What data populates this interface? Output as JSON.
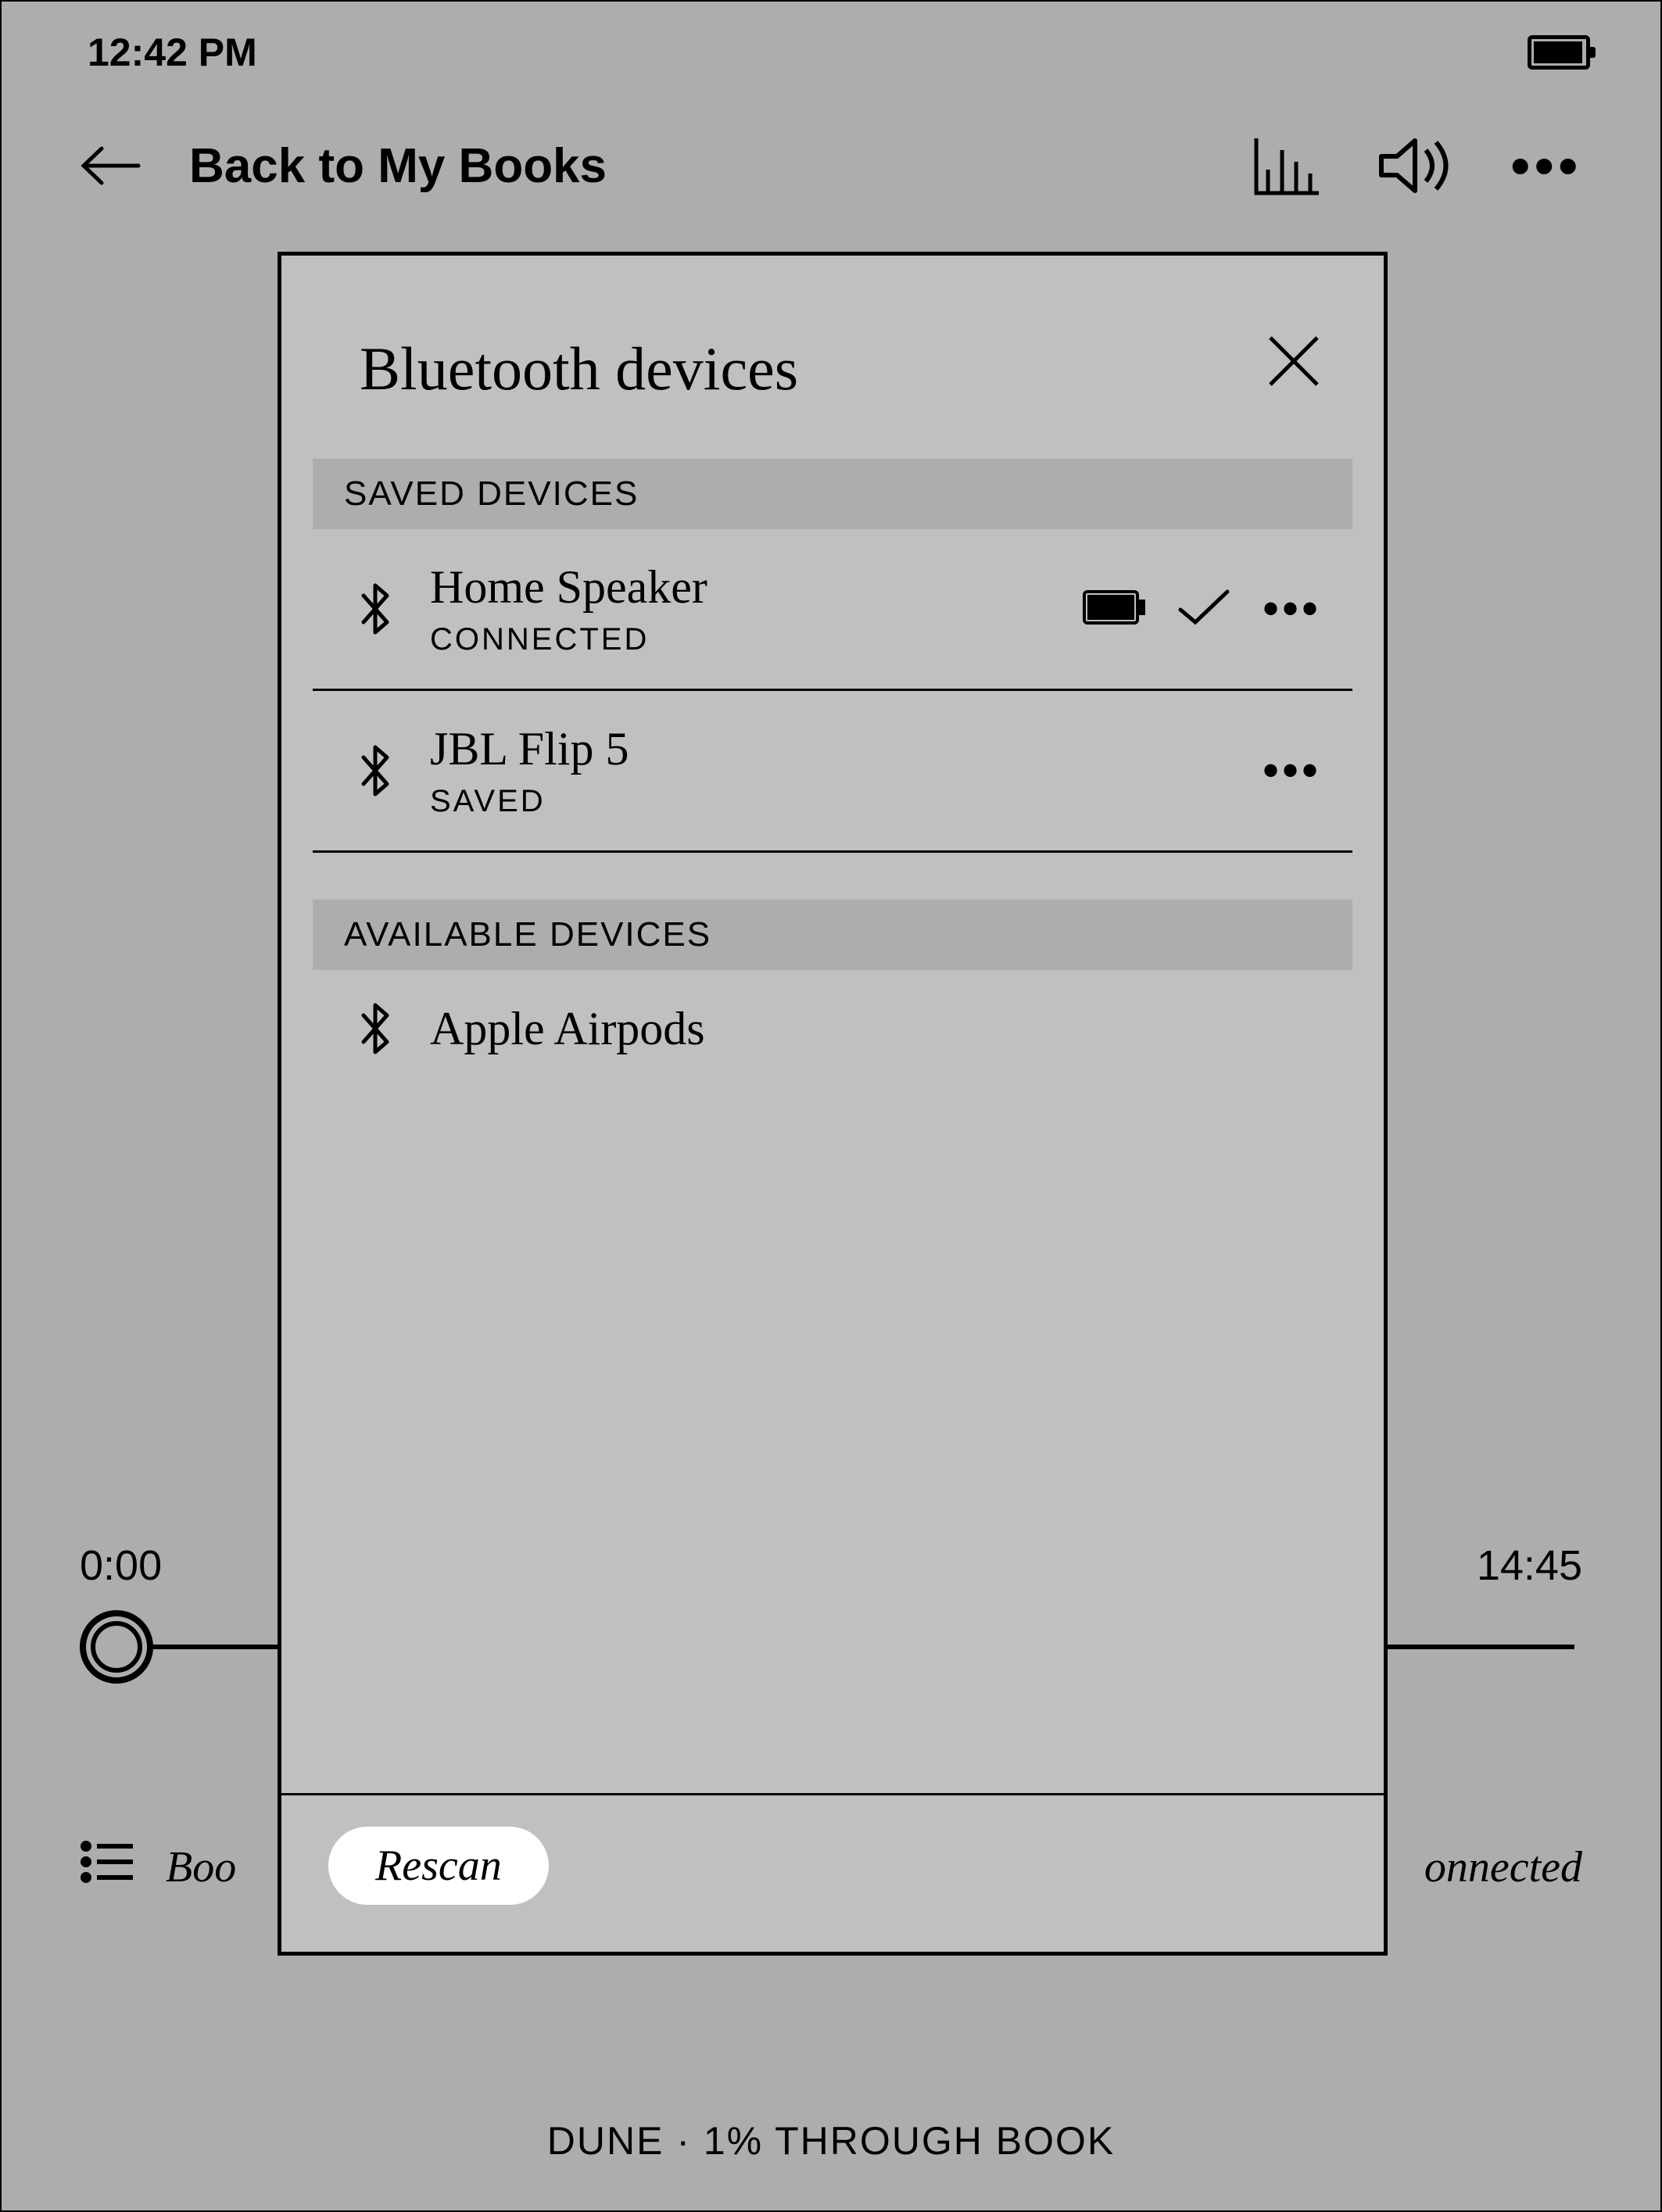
{
  "status": {
    "time": "12:42 PM"
  },
  "nav": {
    "back_label": "Back to My Books"
  },
  "playback": {
    "elapsed": "0:00",
    "remaining": "14:45"
  },
  "bottom": {
    "left_truncated": "Boo",
    "right_truncated": "onnected"
  },
  "footer": {
    "text": "DUNE · 1% THROUGH BOOK"
  },
  "modal": {
    "title": "Bluetooth devices",
    "saved_header": "SAVED DEVICES",
    "available_header": "AVAILABLE DEVICES",
    "rescan_label": "Rescan",
    "saved_devices": [
      {
        "name": "Home Speaker",
        "status": "CONNECTED",
        "show_battery": true,
        "show_check": true
      },
      {
        "name": "JBL Flip 5",
        "status": "SAVED",
        "show_battery": false,
        "show_check": false
      }
    ],
    "available_devices": [
      {
        "name": "Apple Airpods"
      }
    ]
  }
}
